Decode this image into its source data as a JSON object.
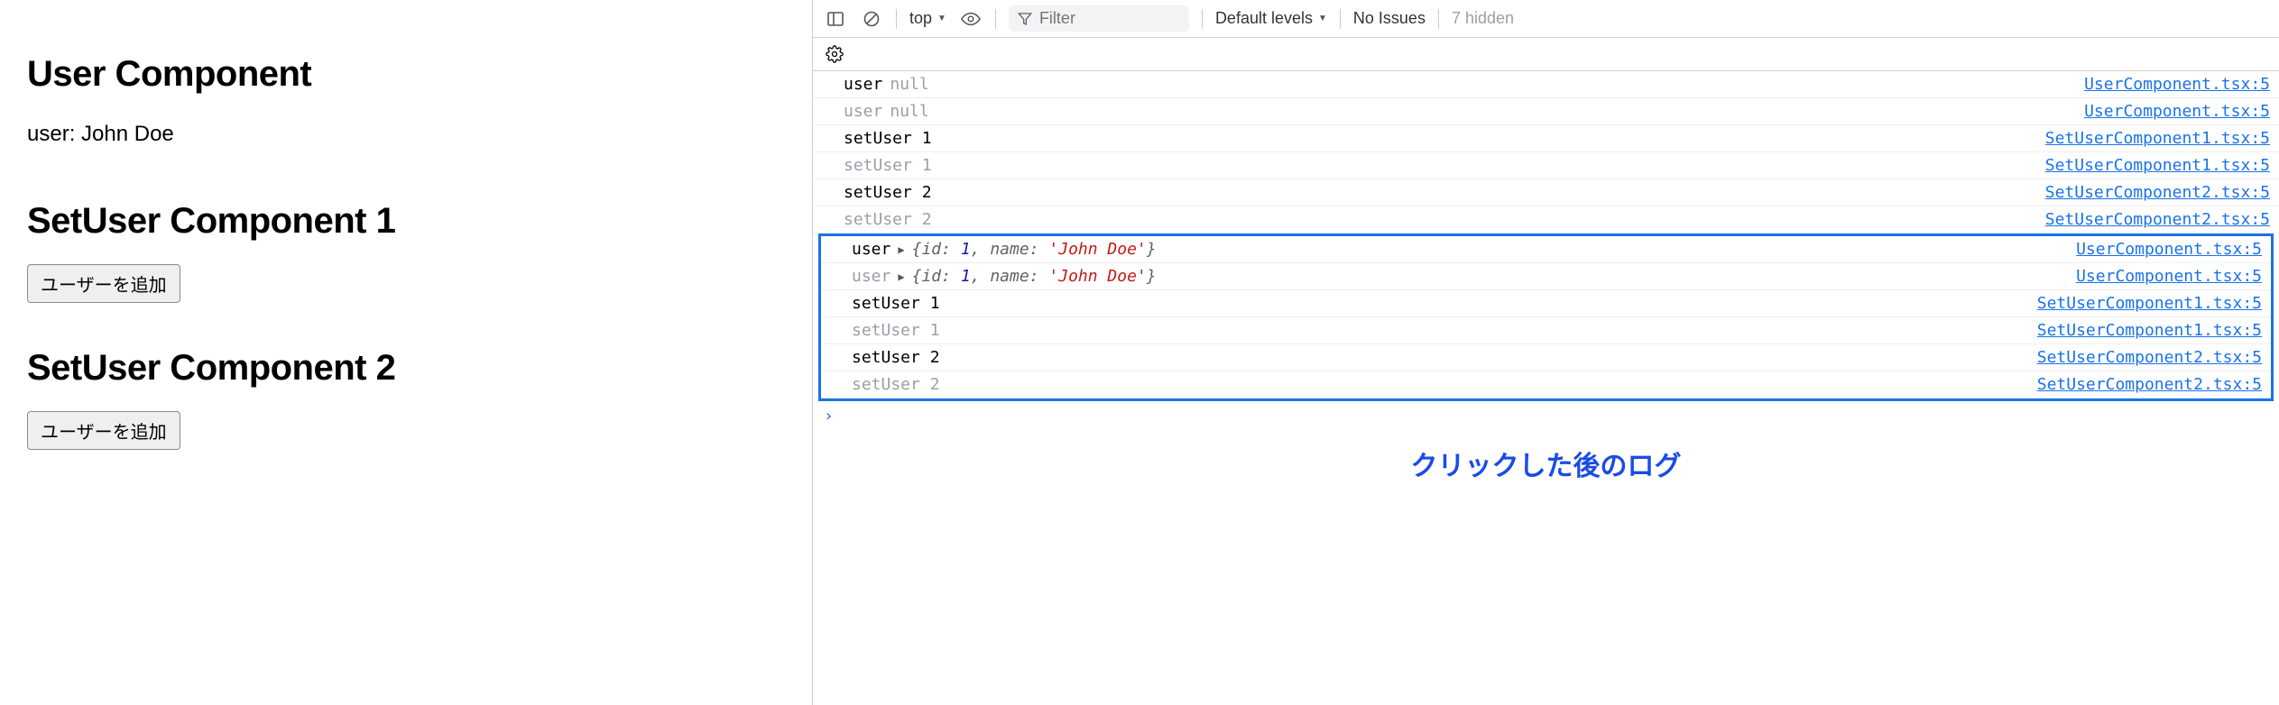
{
  "left": {
    "heading_user": "User Component",
    "user_label": "user:",
    "user_value": "John Doe",
    "heading_set1": "SetUser Component 1",
    "btn_add_user_1": "ユーザーを追加",
    "heading_set2": "SetUser Component 2",
    "btn_add_user_2": "ユーザーを追加"
  },
  "toolbar": {
    "context": "top",
    "filter_placeholder": "Filter",
    "levels": "Default levels",
    "issues": "No Issues",
    "hidden": "7 hidden"
  },
  "logs_top": [
    {
      "dim": false,
      "label": "user",
      "null": true,
      "src": "UserComponent.tsx:5"
    },
    {
      "dim": true,
      "label": "user",
      "null": true,
      "src": "UserComponent.tsx:5"
    },
    {
      "dim": false,
      "label": "setUser 1",
      "src": "SetUserComponent1.tsx:5"
    },
    {
      "dim": true,
      "label": "setUser 1",
      "src": "SetUserComponent1.tsx:5"
    },
    {
      "dim": false,
      "label": "setUser 2",
      "src": "SetUserComponent2.tsx:5"
    },
    {
      "dim": true,
      "label": "setUser 2",
      "src": "SetUserComponent2.tsx:5"
    }
  ],
  "logs_hl": [
    {
      "dim": false,
      "label": "user",
      "obj": {
        "id": 1,
        "name": "John Doe"
      },
      "src": "UserComponent.tsx:5"
    },
    {
      "dim": true,
      "label": "user",
      "obj": {
        "id": 1,
        "name": "John Doe"
      },
      "src": "UserComponent.tsx:5"
    },
    {
      "dim": false,
      "label": "setUser 1",
      "src": "SetUserComponent1.tsx:5"
    },
    {
      "dim": true,
      "label": "setUser 1",
      "src": "SetUserComponent1.tsx:5"
    },
    {
      "dim": false,
      "label": "setUser 2",
      "src": "SetUserComponent2.tsx:5"
    },
    {
      "dim": true,
      "label": "setUser 2",
      "src": "SetUserComponent2.tsx:5"
    }
  ],
  "annotation": "クリックした後のログ"
}
